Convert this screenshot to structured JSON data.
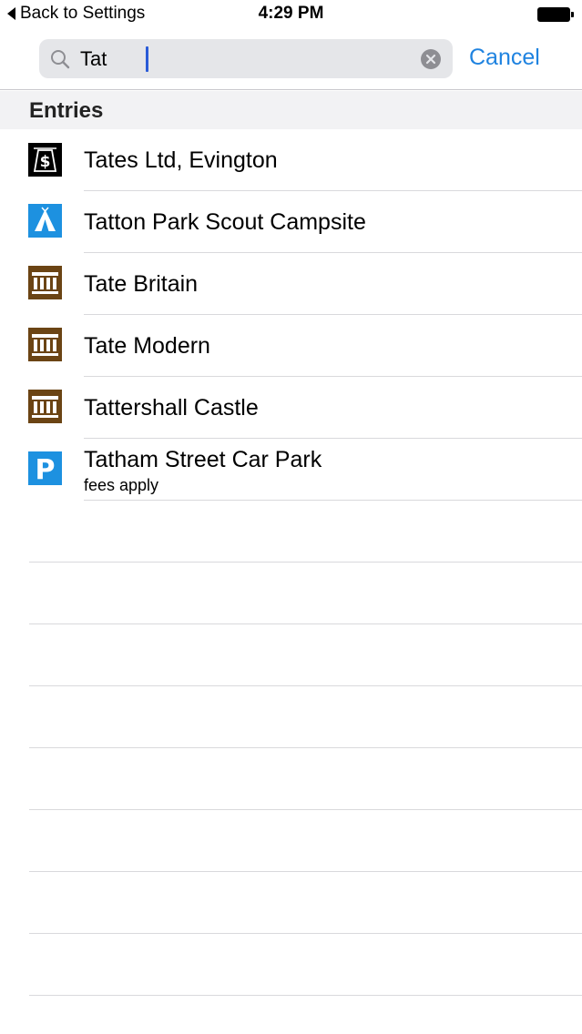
{
  "status_bar": {
    "back_label": "Back to Settings",
    "time": "4:29 PM"
  },
  "search": {
    "value": "Tat",
    "cancel_label": "Cancel"
  },
  "section": {
    "title": "Entries"
  },
  "entries": [
    {
      "title": "Tates Ltd, Evington",
      "subtitle": "",
      "icon": "atm-money-icon",
      "icon_color": "#000000"
    },
    {
      "title": "Tatton Park Scout Campsite",
      "subtitle": "",
      "icon": "campsite-tent-icon",
      "icon_color": "#1d91e0"
    },
    {
      "title": "Tate Britain",
      "subtitle": "",
      "icon": "museum-icon",
      "icon_color": "#6b4414"
    },
    {
      "title": "Tate Modern",
      "subtitle": "",
      "icon": "museum-icon",
      "icon_color": "#6b4414"
    },
    {
      "title": "Tattershall Castle",
      "subtitle": "",
      "icon": "museum-icon",
      "icon_color": "#6b4414"
    },
    {
      "title": "Tatham Street Car Park",
      "subtitle": "fees apply",
      "icon": "parking-icon",
      "icon_color": "#1d91e0"
    }
  ],
  "colors": {
    "accent": "#1f83e0",
    "section_bg": "#f2f2f4",
    "separator": "#d9d9dc"
  }
}
